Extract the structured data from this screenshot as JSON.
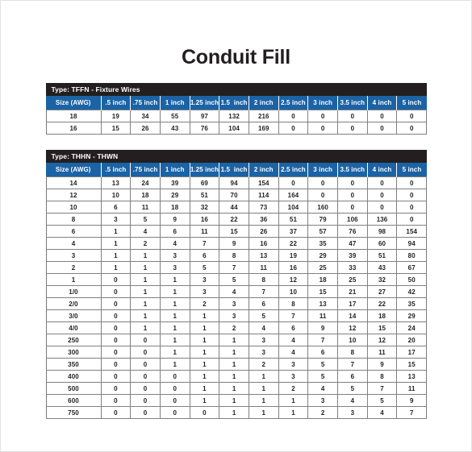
{
  "page": {
    "title": "Conduit Fill"
  },
  "columns": [
    "Size (AWG)",
    ".5 inch",
    ".75 inch",
    "1 inch",
    "1.25 inch",
    "1.5  inch",
    "2 inch",
    "2.5 inch",
    "3 inch",
    "3.5 inch",
    "4 inch",
    "5 inch"
  ],
  "tables": [
    {
      "band_label": "Type: TFFN - Fixture Wires",
      "rows": [
        [
          "18",
          "19",
          "34",
          "55",
          "97",
          "132",
          "216",
          "0",
          "0",
          "0",
          "0",
          "0"
        ],
        [
          "16",
          "15",
          "26",
          "43",
          "76",
          "104",
          "169",
          "0",
          "0",
          "0",
          "0",
          "0"
        ]
      ]
    },
    {
      "band_label": "Type: THHN - THWN",
      "rows": [
        [
          "14",
          "13",
          "24",
          "39",
          "69",
          "94",
          "154",
          "0",
          "0",
          "0",
          "0",
          "0"
        ],
        [
          "12",
          "10",
          "18",
          "29",
          "51",
          "70",
          "114",
          "164",
          "0",
          "0",
          "0",
          "0"
        ],
        [
          "10",
          "6",
          "11",
          "18",
          "32",
          "44",
          "73",
          "104",
          "160",
          "0",
          "0",
          "0"
        ],
        [
          "8",
          "3",
          "5",
          "9",
          "16",
          "22",
          "36",
          "51",
          "79",
          "106",
          "136",
          "0"
        ],
        [
          "6",
          "1",
          "4",
          "6",
          "11",
          "15",
          "26",
          "37",
          "57",
          "76",
          "98",
          "154"
        ],
        [
          "4",
          "1",
          "2",
          "4",
          "7",
          "9",
          "16",
          "22",
          "35",
          "47",
          "60",
          "94"
        ],
        [
          "3",
          "1",
          "1",
          "3",
          "6",
          "8",
          "13",
          "19",
          "29",
          "39",
          "51",
          "80"
        ],
        [
          "2",
          "1",
          "1",
          "3",
          "5",
          "7",
          "11",
          "16",
          "25",
          "33",
          "43",
          "67"
        ],
        [
          "1",
          "0",
          "1",
          "1",
          "3",
          "5",
          "8",
          "12",
          "18",
          "25",
          "32",
          "50"
        ],
        [
          "1/0",
          "0",
          "1",
          "1",
          "3",
          "4",
          "7",
          "10",
          "15",
          "21",
          "27",
          "42"
        ],
        [
          "2/0",
          "0",
          "1",
          "1",
          "2",
          "3",
          "6",
          "8",
          "13",
          "17",
          "22",
          "35"
        ],
        [
          "3/0",
          "0",
          "1",
          "1",
          "1",
          "3",
          "5",
          "7",
          "11",
          "14",
          "18",
          "29"
        ],
        [
          "4/0",
          "0",
          "1",
          "1",
          "1",
          "2",
          "4",
          "6",
          "9",
          "12",
          "15",
          "24"
        ],
        [
          "250",
          "0",
          "0",
          "1",
          "1",
          "1",
          "3",
          "4",
          "7",
          "10",
          "12",
          "20"
        ],
        [
          "300",
          "0",
          "0",
          "1",
          "1",
          "1",
          "3",
          "4",
          "6",
          "8",
          "11",
          "17"
        ],
        [
          "350",
          "0",
          "0",
          "1",
          "1",
          "1",
          "2",
          "3",
          "5",
          "7",
          "9",
          "15"
        ],
        [
          "400",
          "0",
          "0",
          "0",
          "1",
          "1",
          "1",
          "3",
          "5",
          "6",
          "8",
          "13"
        ],
        [
          "500",
          "0",
          "0",
          "0",
          "1",
          "1",
          "1",
          "2",
          "4",
          "5",
          "7",
          "11"
        ],
        [
          "600",
          "0",
          "0",
          "0",
          "1",
          "1",
          "1",
          "1",
          "3",
          "4",
          "5",
          "9"
        ],
        [
          "750",
          "0",
          "0",
          "0",
          "0",
          "1",
          "1",
          "1",
          "2",
          "3",
          "4",
          "7"
        ]
      ]
    }
  ],
  "colors": {
    "header_blue": "#1b63a5",
    "band_black": "#231f20",
    "text": "#231f20",
    "grid": "#808080"
  }
}
